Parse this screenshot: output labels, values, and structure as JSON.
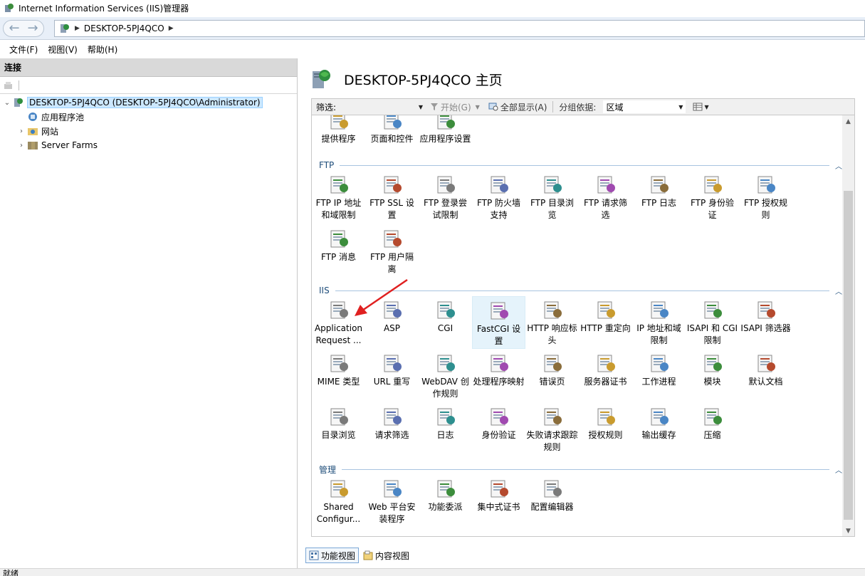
{
  "window": {
    "title": "Internet Information Services (IIS)管理器"
  },
  "address": {
    "crumbs": [
      "DESKTOP-5PJ4QCO"
    ]
  },
  "menu": {
    "items": [
      "文件(F)",
      "视图(V)",
      "帮助(H)"
    ]
  },
  "connections": {
    "header": "连接",
    "tree": [
      {
        "label": "DESKTOP-5PJ4QCO (DESKTOP-5PJ4QCO\\Administrator)",
        "expander": "⌄",
        "selected": true
      },
      {
        "label": "应用程序池",
        "expander": ""
      },
      {
        "label": "网站",
        "expander": "›"
      },
      {
        "label": "Server Farms",
        "expander": "›"
      }
    ]
  },
  "home": {
    "title": "DESKTOP-5PJ4QCO 主页"
  },
  "filter": {
    "label": "筛选:",
    "start_label": "开始(G)",
    "show_all_label": "全部显示(A)",
    "group_by_label": "分组依据:",
    "group_by_value": "区域"
  },
  "groups": {
    "top": {
      "items": [
        "提供程序",
        "页面和控件",
        "应用程序设置"
      ]
    },
    "ftp": {
      "name": "FTP",
      "items": [
        "FTP IP 地址和域限制",
        "FTP SSL 设置",
        "FTP 登录尝试限制",
        "FTP 防火墙支持",
        "FTP 目录浏览",
        "FTP 请求筛选",
        "FTP 日志",
        "FTP 身份验证",
        "FTP 授权规则",
        "FTP 消息",
        "FTP 用户隔离"
      ]
    },
    "iis": {
      "name": "IIS",
      "items": [
        "Application Request ...",
        "ASP",
        "CGI",
        "FastCGI 设置",
        "HTTP 响应标头",
        "HTTP 重定向",
        "IP 地址和域限制",
        "ISAPI 和 CGI 限制",
        "ISAPI 筛选器",
        "MIME 类型",
        "URL 重写",
        "WebDAV 创作规则",
        "处理程序映射",
        "错误页",
        "服务器证书",
        "工作进程",
        "模块",
        "默认文档",
        "目录浏览",
        "请求筛选",
        "日志",
        "身份验证",
        "失败请求跟踪规则",
        "授权规则",
        "输出缓存",
        "压缩"
      ]
    },
    "manage": {
      "name": "管理",
      "items": [
        "Shared Configur...",
        "Web 平台安装程序",
        "功能委派",
        "集中式证书",
        "配置编辑器"
      ]
    }
  },
  "tabs": {
    "features": "功能视图",
    "content": "内容视图"
  },
  "status": {
    "text": "就绪"
  }
}
